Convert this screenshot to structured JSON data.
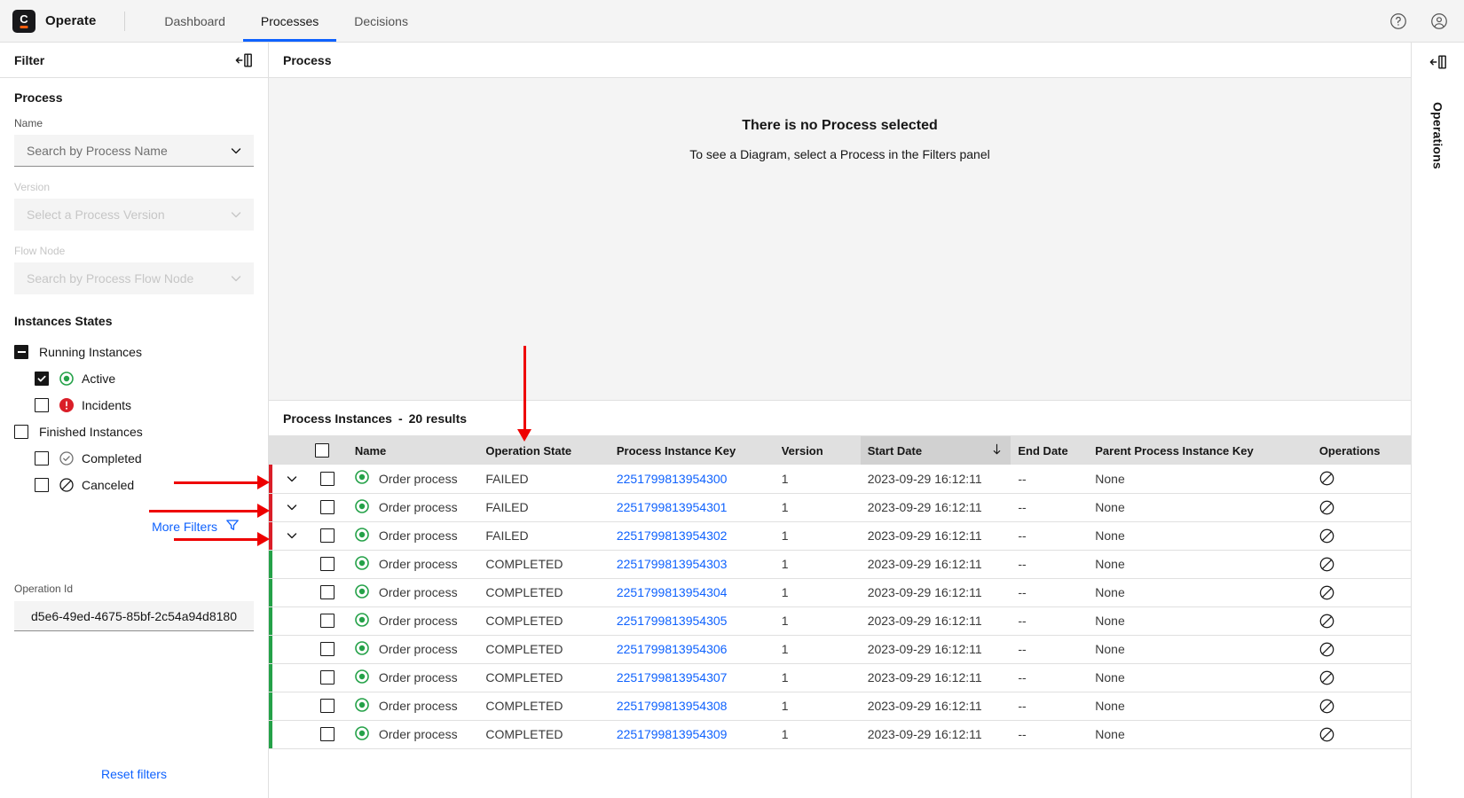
{
  "topnav": {
    "brand": "Operate",
    "brand_mark": "C",
    "items": [
      {
        "label": "Dashboard",
        "active": false
      },
      {
        "label": "Processes",
        "active": true
      },
      {
        "label": "Decisions",
        "active": false
      }
    ],
    "help_icon": "help-icon",
    "user_icon": "user-avatar-icon",
    "accent_color": "#0f62fe"
  },
  "filters": {
    "title": "Filter",
    "collapse_icon": "collapse-panel-icon",
    "process_section": "Process",
    "name_label": "Name",
    "name_placeholder": "Search by Process Name",
    "version_label": "Version",
    "version_placeholder": "Select a Process Version",
    "flownode_label": "Flow Node",
    "flownode_placeholder": "Search by Process Flow Node",
    "states_title": "Instances States",
    "running_label": "Running Instances",
    "active_label": "Active",
    "incidents_label": "Incidents",
    "finished_label": "Finished Instances",
    "completed_label": "Completed",
    "canceled_label": "Canceled",
    "more_filters_label": "More Filters",
    "more_filters_icon": "filter-icon",
    "operation_id_label": "Operation Id",
    "operation_id_value": "d5e6-49ed-4675-85bf-2c54a94d8180",
    "reset_label": "Reset filters",
    "link_color": "#0f62fe",
    "active_color": "#24a148",
    "incident_color": "#da1e28"
  },
  "diagram": {
    "panel_title": "Process",
    "empty_title": "There is no Process selected",
    "empty_sub": "To see a Diagram, select a Process in the Filters panel"
  },
  "instances": {
    "title": "Process Instances",
    "separator": "-",
    "count_label": "20 results",
    "columns": [
      {
        "key": "expand",
        "label": "",
        "sorted": false
      },
      {
        "key": "select",
        "label": "",
        "sorted": false
      },
      {
        "key": "name",
        "label": "Name",
        "sorted": false
      },
      {
        "key": "operation_state",
        "label": "Operation State",
        "sorted": false
      },
      {
        "key": "process_instance_key",
        "label": "Process Instance Key",
        "sorted": false
      },
      {
        "key": "version",
        "label": "Version",
        "sorted": false
      },
      {
        "key": "start_date",
        "label": "Start Date",
        "sorted": true,
        "sort_dir": "desc"
      },
      {
        "key": "end_date",
        "label": "End Date",
        "sorted": false
      },
      {
        "key": "parent_process_instance_key",
        "label": "Parent Process Instance Key",
        "sorted": false
      },
      {
        "key": "operations",
        "label": "Operations",
        "sorted": false
      }
    ],
    "rows": [
      {
        "expandable": true,
        "state": "failed",
        "name": "Order process",
        "operation_state": "FAILED",
        "process_instance_key": "2251799813954300",
        "version": "1",
        "start_date": "2023-09-29 16:12:11",
        "end_date": "--",
        "parent_process_instance_key": "None",
        "operation_icon": "cancel-operation-icon"
      },
      {
        "expandable": true,
        "state": "failed",
        "name": "Order process",
        "operation_state": "FAILED",
        "process_instance_key": "2251799813954301",
        "version": "1",
        "start_date": "2023-09-29 16:12:11",
        "end_date": "--",
        "parent_process_instance_key": "None",
        "operation_icon": "cancel-operation-icon"
      },
      {
        "expandable": true,
        "state": "failed",
        "name": "Order process",
        "operation_state": "FAILED",
        "process_instance_key": "2251799813954302",
        "version": "1",
        "start_date": "2023-09-29 16:12:11",
        "end_date": "--",
        "parent_process_instance_key": "None",
        "operation_icon": "cancel-operation-icon"
      },
      {
        "expandable": false,
        "state": "completed",
        "name": "Order process",
        "operation_state": "COMPLETED",
        "process_instance_key": "2251799813954303",
        "version": "1",
        "start_date": "2023-09-29 16:12:11",
        "end_date": "--",
        "parent_process_instance_key": "None",
        "operation_icon": "cancel-operation-icon"
      },
      {
        "expandable": false,
        "state": "completed",
        "name": "Order process",
        "operation_state": "COMPLETED",
        "process_instance_key": "2251799813954304",
        "version": "1",
        "start_date": "2023-09-29 16:12:11",
        "end_date": "--",
        "parent_process_instance_key": "None",
        "operation_icon": "cancel-operation-icon"
      },
      {
        "expandable": false,
        "state": "completed",
        "name": "Order process",
        "operation_state": "COMPLETED",
        "process_instance_key": "2251799813954305",
        "version": "1",
        "start_date": "2023-09-29 16:12:11",
        "end_date": "--",
        "parent_process_instance_key": "None",
        "operation_icon": "cancel-operation-icon"
      },
      {
        "expandable": false,
        "state": "completed",
        "name": "Order process",
        "operation_state": "COMPLETED",
        "process_instance_key": "2251799813954306",
        "version": "1",
        "start_date": "2023-09-29 16:12:11",
        "end_date": "--",
        "parent_process_instance_key": "None",
        "operation_icon": "cancel-operation-icon"
      },
      {
        "expandable": false,
        "state": "completed",
        "name": "Order process",
        "operation_state": "COMPLETED",
        "process_instance_key": "2251799813954307",
        "version": "1",
        "start_date": "2023-09-29 16:12:11",
        "end_date": "--",
        "parent_process_instance_key": "None",
        "operation_icon": "cancel-operation-icon"
      },
      {
        "expandable": false,
        "state": "completed",
        "name": "Order process",
        "operation_state": "COMPLETED",
        "process_instance_key": "2251799813954308",
        "version": "1",
        "start_date": "2023-09-29 16:12:11",
        "end_date": "--",
        "parent_process_instance_key": "None",
        "operation_icon": "cancel-operation-icon"
      },
      {
        "expandable": false,
        "state": "completed",
        "name": "Order process",
        "operation_state": "COMPLETED",
        "process_instance_key": "2251799813954309",
        "version": "1",
        "start_date": "2023-09-29 16:12:11",
        "end_date": "--",
        "parent_process_instance_key": "None",
        "operation_icon": "cancel-operation-icon"
      }
    ]
  },
  "right_rail": {
    "collapse_icon": "expand-panel-icon",
    "label": "Operations"
  },
  "annotations": {
    "color": "#ee0000",
    "arrows": [
      {
        "name": "arrow-to-row-1",
        "dir": "right"
      },
      {
        "name": "arrow-to-row-2",
        "dir": "right"
      },
      {
        "name": "arrow-to-row-3",
        "dir": "right"
      },
      {
        "name": "arrow-to-operation-state-column",
        "dir": "down"
      }
    ]
  }
}
